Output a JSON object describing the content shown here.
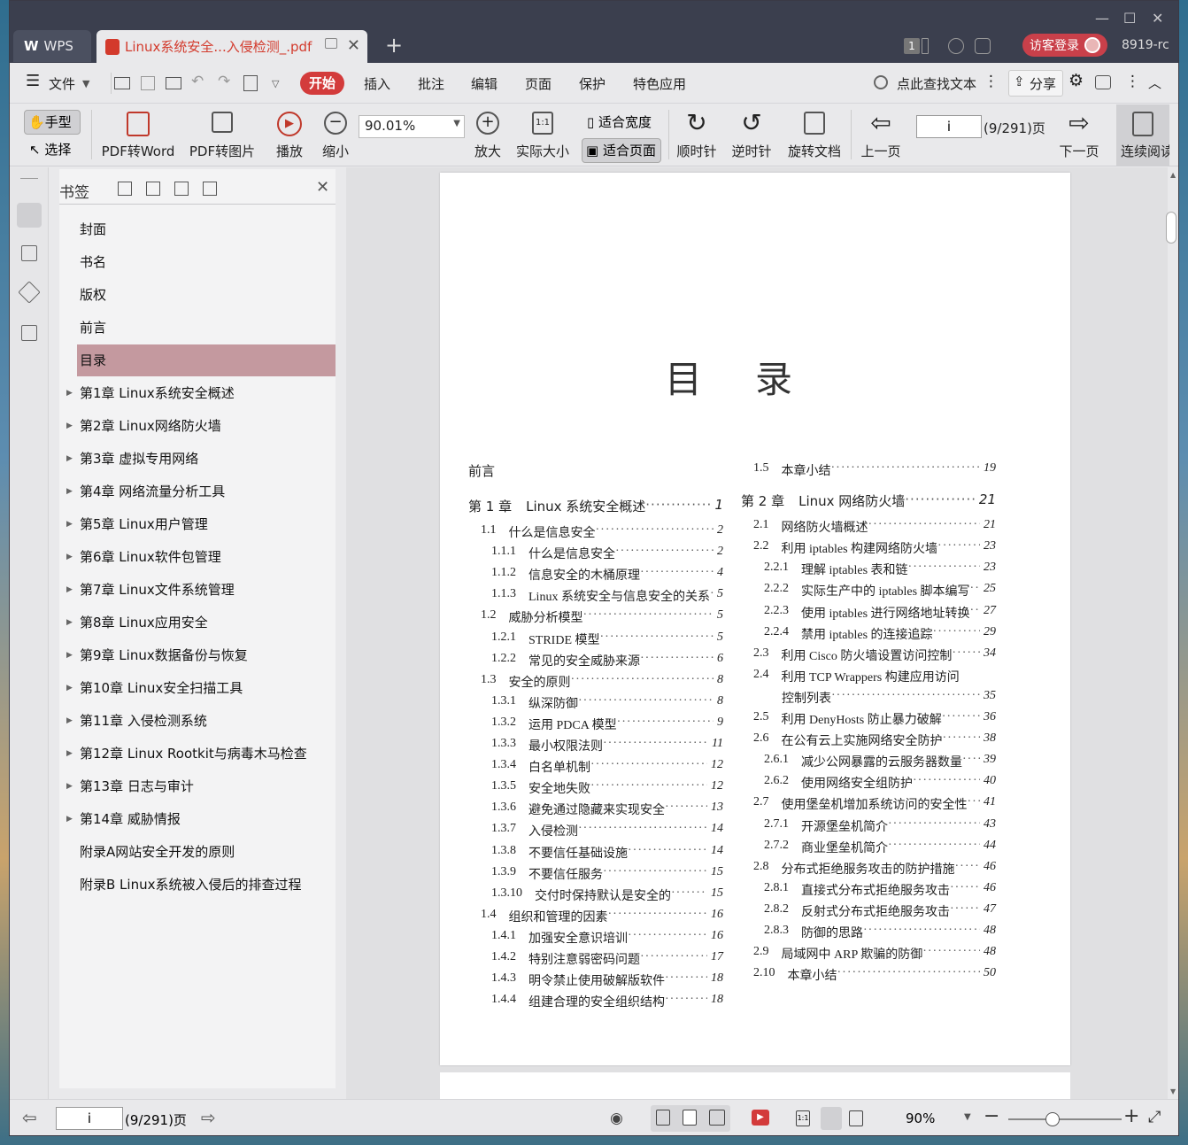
{
  "window": {
    "minimize": "—",
    "maximize": "☐",
    "close": "✕"
  },
  "tabs": {
    "wps": "WPS",
    "doc": "Linux系统安全...入侵检测_.pdf",
    "new": "+"
  },
  "title_right": {
    "page_badge": "1",
    "login": "访客登录",
    "user": "8919-rc"
  },
  "menu": {
    "file": "文件",
    "start": "开始",
    "items": [
      "插入",
      "批注",
      "编辑",
      "页面",
      "保护",
      "特色应用"
    ],
    "search": "点此查找文本",
    "share": "分享"
  },
  "toolbar": {
    "hand": "手型",
    "select": "选择",
    "pdf2word": "PDF转Word",
    "pdf2img": "PDF转图片",
    "play": "播放",
    "zoomout": "缩小",
    "zoom": "90.01%",
    "zoomin": "放大",
    "actual": "实际大小",
    "fitwidth": "适合宽度",
    "fitpage": "适合页面",
    "cw": "顺时针",
    "ccw": "逆时针",
    "rotate": "旋转文档",
    "prev": "上一页",
    "page": "i",
    "pagecount": "(9/291)页",
    "next": "下一页",
    "continuous": "连续阅读"
  },
  "bookmark": {
    "title": "书签",
    "items": [
      {
        "label": "封面",
        "expand": false
      },
      {
        "label": "书名",
        "expand": false
      },
      {
        "label": "版权",
        "expand": false
      },
      {
        "label": "前言",
        "expand": false
      },
      {
        "label": "目录",
        "expand": false,
        "selected": true
      },
      {
        "label": "第1章 Linux系统安全概述",
        "expand": true
      },
      {
        "label": "第2章 Linux网络防火墙",
        "expand": true
      },
      {
        "label": "第3章 虚拟专用网络",
        "expand": true
      },
      {
        "label": "第4章 网络流量分析工具",
        "expand": true
      },
      {
        "label": "第5章 Linux用户管理",
        "expand": true
      },
      {
        "label": "第6章 Linux软件包管理",
        "expand": true
      },
      {
        "label": "第7章 Linux文件系统管理",
        "expand": true
      },
      {
        "label": "第8章 Linux应用安全",
        "expand": true
      },
      {
        "label": "第9章 Linux数据备份与恢复",
        "expand": true
      },
      {
        "label": "第10章 Linux安全扫描工具",
        "expand": true
      },
      {
        "label": "第11章 入侵检测系统",
        "expand": true
      },
      {
        "label": "第12章 Linux Rootkit与病毒木马检查",
        "expand": true
      },
      {
        "label": "第13章 日志与审计",
        "expand": true
      },
      {
        "label": "第14章 威胁情报",
        "expand": true
      },
      {
        "label": "附录A网站安全开发的原则",
        "expand": false
      },
      {
        "label": "附录B Linux系统被入侵后的排查过程",
        "expand": false
      }
    ]
  },
  "toc": {
    "title": "目录",
    "left": [
      {
        "num": "前言",
        "text": "",
        "page": "",
        "lv": 0
      },
      {
        "num": "第 1 章",
        "text": "Linux 系统安全概述",
        "page": "1",
        "lv": 0
      },
      {
        "num": "1.1",
        "text": "什么是信息安全",
        "page": "2",
        "lv": 1
      },
      {
        "num": "1.1.1",
        "text": "什么是信息安全",
        "page": "2",
        "lv": 2
      },
      {
        "num": "1.1.2",
        "text": "信息安全的木桶原理",
        "page": "4",
        "lv": 2
      },
      {
        "num": "1.1.3",
        "text": "Linux 系统安全与信息安全的关系",
        "page": "5",
        "lv": 2
      },
      {
        "num": "1.2",
        "text": "威胁分析模型",
        "page": "5",
        "lv": 1
      },
      {
        "num": "1.2.1",
        "text": "STRIDE 模型",
        "page": "5",
        "lv": 2
      },
      {
        "num": "1.2.2",
        "text": "常见的安全威胁来源",
        "page": "6",
        "lv": 2
      },
      {
        "num": "1.3",
        "text": "安全的原则",
        "page": "8",
        "lv": 1
      },
      {
        "num": "1.3.1",
        "text": "纵深防御",
        "page": "8",
        "lv": 2
      },
      {
        "num": "1.3.2",
        "text": "运用 PDCA 模型",
        "page": "9",
        "lv": 2
      },
      {
        "num": "1.3.3",
        "text": "最小权限法则",
        "page": "11",
        "lv": 2
      },
      {
        "num": "1.3.4",
        "text": "白名单机制",
        "page": "12",
        "lv": 2
      },
      {
        "num": "1.3.5",
        "text": "安全地失败",
        "page": "12",
        "lv": 2
      },
      {
        "num": "1.3.6",
        "text": "避免通过隐藏来实现安全",
        "page": "13",
        "lv": 2
      },
      {
        "num": "1.3.7",
        "text": "入侵检测",
        "page": "14",
        "lv": 2
      },
      {
        "num": "1.3.8",
        "text": "不要信任基础设施",
        "page": "14",
        "lv": 2
      },
      {
        "num": "1.3.9",
        "text": "不要信任服务",
        "page": "15",
        "lv": 2
      },
      {
        "num": "1.3.10",
        "text": "交付时保持默认是安全的",
        "page": "15",
        "lv": 2
      },
      {
        "num": "1.4",
        "text": "组织和管理的因素",
        "page": "16",
        "lv": 1
      },
      {
        "num": "1.4.1",
        "text": "加强安全意识培训",
        "page": "16",
        "lv": 2
      },
      {
        "num": "1.4.2",
        "text": "特别注意弱密码问题",
        "page": "17",
        "lv": 2
      },
      {
        "num": "1.4.3",
        "text": "明令禁止使用破解版软件",
        "page": "18",
        "lv": 2
      },
      {
        "num": "1.4.4",
        "text": "组建合理的安全组织结构",
        "page": "18",
        "lv": 2
      }
    ],
    "right": [
      {
        "num": "1.5",
        "text": "本章小结",
        "page": "19",
        "lv": 1
      },
      {
        "num": "第 2 章",
        "text": "Linux 网络防火墙",
        "page": "21",
        "lv": 0
      },
      {
        "num": "2.1",
        "text": "网络防火墙概述",
        "page": "21",
        "lv": 1
      },
      {
        "num": "2.2",
        "text": "利用 iptables 构建网络防火墙",
        "page": "23",
        "lv": 1
      },
      {
        "num": "2.2.1",
        "text": "理解 iptables 表和链",
        "page": "23",
        "lv": 2
      },
      {
        "num": "2.2.2",
        "text": "实际生产中的 iptables 脚本编写",
        "page": "25",
        "lv": 2
      },
      {
        "num": "2.2.3",
        "text": "使用 iptables 进行网络地址转换",
        "page": "27",
        "lv": 2
      },
      {
        "num": "2.2.4",
        "text": "禁用 iptables 的连接追踪",
        "page": "29",
        "lv": 2
      },
      {
        "num": "2.3",
        "text": "利用 Cisco 防火墙设置访问控制",
        "page": "34",
        "lv": 1
      },
      {
        "num": "2.4",
        "text": "利用 TCP Wrappers 构建应用访问",
        "page": "",
        "lv": 1
      },
      {
        "num": "",
        "text": "控制列表",
        "page": "35",
        "lv": 3
      },
      {
        "num": "2.5",
        "text": "利用 DenyHosts 防止暴力破解",
        "page": "36",
        "lv": 1
      },
      {
        "num": "2.6",
        "text": "在公有云上实施网络安全防护",
        "page": "38",
        "lv": 1
      },
      {
        "num": "2.6.1",
        "text": "减少公网暴露的云服务器数量",
        "page": "39",
        "lv": 2
      },
      {
        "num": "2.6.2",
        "text": "使用网络安全组防护",
        "page": "40",
        "lv": 2
      },
      {
        "num": "2.7",
        "text": "使用堡垒机增加系统访问的安全性",
        "page": "41",
        "lv": 1
      },
      {
        "num": "2.7.1",
        "text": "开源堡垒机简介",
        "page": "43",
        "lv": 2
      },
      {
        "num": "2.7.2",
        "text": "商业堡垒机简介",
        "page": "44",
        "lv": 2
      },
      {
        "num": "2.8",
        "text": "分布式拒绝服务攻击的防护措施",
        "page": "46",
        "lv": 1
      },
      {
        "num": "2.8.1",
        "text": "直接式分布式拒绝服务攻击",
        "page": "46",
        "lv": 2
      },
      {
        "num": "2.8.2",
        "text": "反射式分布式拒绝服务攻击",
        "page": "47",
        "lv": 2
      },
      {
        "num": "2.8.3",
        "text": "防御的思路",
        "page": "48",
        "lv": 2
      },
      {
        "num": "2.9",
        "text": "局域网中 ARP 欺骗的防御",
        "page": "48",
        "lv": 1
      },
      {
        "num": "2.10",
        "text": "本章小结",
        "page": "50",
        "lv": 1
      }
    ]
  },
  "status": {
    "page": "i",
    "pagecount": "(9/291)页",
    "zoom": "90%"
  }
}
